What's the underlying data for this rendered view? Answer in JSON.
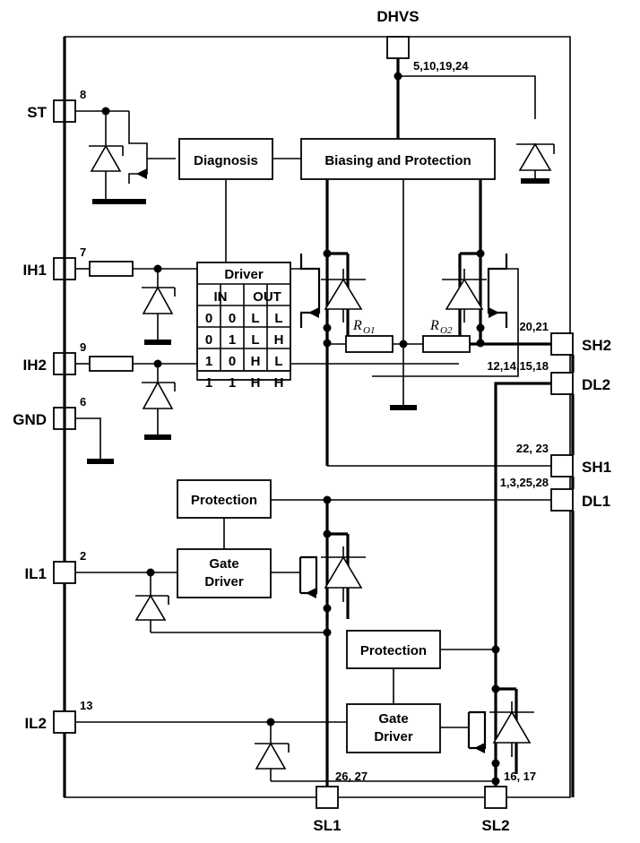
{
  "diagram": {
    "title_top": "DHVS",
    "blocks": [
      {
        "id": "diagnosis",
        "label": "Diagnosis"
      },
      {
        "id": "biasing",
        "label": "Biasing and Protection"
      },
      {
        "id": "protection1",
        "label": "Protection"
      },
      {
        "id": "gatedriver1",
        "label_line1": "Gate",
        "label_line2": "Driver"
      },
      {
        "id": "protection2",
        "label": "Protection"
      },
      {
        "id": "gatedriver2",
        "label_line1": "Gate",
        "label_line2": "Driver"
      }
    ],
    "driver_table": {
      "title": "Driver",
      "group_headers": [
        "IN",
        "OUT"
      ],
      "rows": [
        [
          "0",
          "0",
          "L",
          "L"
        ],
        [
          "0",
          "1",
          "L",
          "H"
        ],
        [
          "1",
          "0",
          "H",
          "L"
        ],
        [
          "1",
          "1",
          "H",
          "H"
        ]
      ]
    },
    "resistors": [
      {
        "id": "ro1",
        "name": "R",
        "subscript": "O1"
      },
      {
        "id": "ro2",
        "name": "R",
        "subscript": "O2"
      }
    ],
    "pins_left": [
      {
        "name": "ST",
        "number": "8"
      },
      {
        "name": "IH1",
        "number": "7"
      },
      {
        "name": "IH2",
        "number": "9"
      },
      {
        "name": "GND",
        "number": "6"
      },
      {
        "name": "IL1",
        "number": "2"
      },
      {
        "name": "IL2",
        "number": "13"
      }
    ],
    "pins_right": [
      {
        "name": "SH2",
        "number": "20,21"
      },
      {
        "name": "DL2",
        "number": "12,14,15,18"
      },
      {
        "name": "SH1",
        "number": "22, 23"
      },
      {
        "name": "DL1",
        "number": "1,3,25,28"
      }
    ],
    "pins_top": [
      {
        "name": "DHVS",
        "number": "5,10,19,24"
      }
    ],
    "pins_bottom": [
      {
        "name": "SL1",
        "number": "26, 27"
      },
      {
        "name": "SL2",
        "number": "16, 17"
      }
    ],
    "colors": {
      "line": "#000000",
      "background": "#ffffff",
      "fill": "#ffffff"
    }
  }
}
